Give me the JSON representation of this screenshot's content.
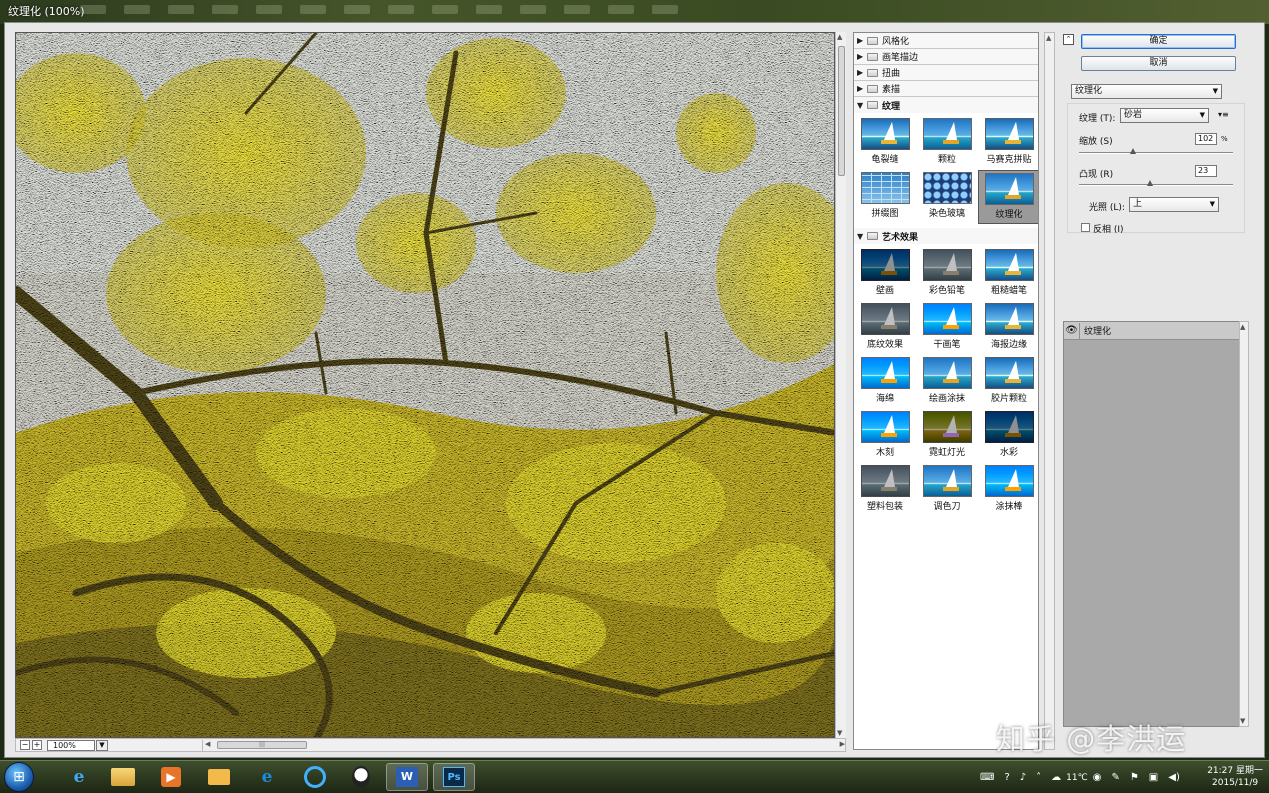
{
  "window": {
    "title": "纹理化 (100%)"
  },
  "preview": {
    "zoom": "100%"
  },
  "gallery": {
    "categories": [
      {
        "label": "风格化",
        "open": false
      },
      {
        "label": "画笔描边",
        "open": false
      },
      {
        "label": "扭曲",
        "open": false
      },
      {
        "label": "素描",
        "open": false
      },
      {
        "label": "纹理",
        "open": true,
        "items": [
          "龟裂缝",
          "颗粒",
          "马赛克拼贴",
          "拼缀图",
          "染色玻璃",
          "纹理化"
        ],
        "selected": "纹理化"
      },
      {
        "label": "艺术效果",
        "open": true,
        "items": [
          "壁画",
          "彩色铅笔",
          "粗糙蜡笔",
          "底纹效果",
          "干画笔",
          "海报边缘",
          "海绵",
          "绘画涂抹",
          "胶片颗粒",
          "木刻",
          "霓虹灯光",
          "水彩",
          "塑料包装",
          "调色刀",
          "涂抹棒"
        ]
      }
    ]
  },
  "buttons": {
    "ok": "确定",
    "cancel": "取消"
  },
  "params": {
    "filter_select": "纹理化",
    "texture_label": "纹理 (T):",
    "texture_value": "砂岩",
    "scale_label": "缩放 (S)",
    "scale_value": "102",
    "scale_unit": "%",
    "scale_level": 0.35,
    "relief_label": "凸现 (R)",
    "relief_value": "23",
    "relief_level": 0.46,
    "light_label": "光照 (L):",
    "light_value": "上",
    "invert_label": "反相 (I)",
    "invert_checked": false
  },
  "layers": {
    "items": [
      "纹理化"
    ]
  },
  "watermark": "知乎 @李洪运",
  "taskbar": {
    "apps": [
      "internet-explorer-icon",
      "file-explorer-icon",
      "media-player-icon",
      "mail-icon",
      "ie-icon",
      "network-icon",
      "qq-icon",
      "word-icon",
      "photoshop-icon"
    ],
    "temperature": "11℃",
    "time": "21:27 星期一",
    "date": "2015/11/9"
  }
}
